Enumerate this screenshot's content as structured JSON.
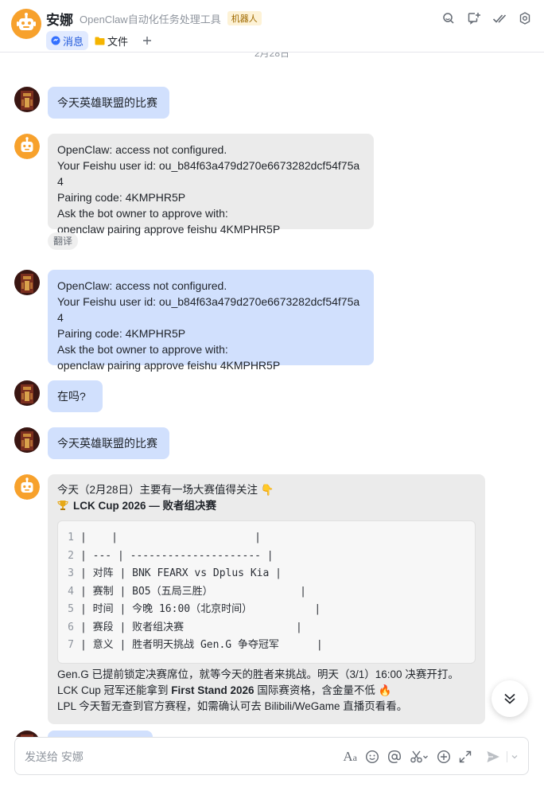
{
  "header": {
    "title": "安娜",
    "subtitle": "OpenClaw自动化任务处理工具",
    "badge": "机器人",
    "tabs": [
      {
        "label": "消息",
        "icon": "chat-bubble-icon",
        "active": true
      },
      {
        "label": "文件",
        "icon": "folder-icon",
        "active": false
      }
    ],
    "actions": [
      "search-icon",
      "add-chat-icon",
      "check-marks-icon",
      "settings-icon"
    ]
  },
  "date_divider": "2月28日",
  "messages": [
    {
      "sender": "user",
      "text": "今天英雄联盟的比赛"
    },
    {
      "sender": "bot",
      "text": "OpenClaw: access not configured.\nYour Feishu user id: ou_b84f63a479d270e6673282dcf54f75a4\nPairing code: 4KMPHR5P\nAsk the bot owner to approve with:\nopenclaw pairing approve feishu 4KMPHR5P",
      "action": "翻译"
    },
    {
      "sender": "user",
      "text": "OpenClaw: access not configured.\nYour Feishu user id: ou_b84f63a479d270e6673282dcf54f75a4\nPairing code: 4KMPHR5P\nAsk the bot owner to approve with:\nopenclaw pairing approve feishu 4KMPHR5P"
    },
    {
      "sender": "user",
      "text": "在吗?"
    },
    {
      "sender": "user",
      "text": "今天英雄联盟的比赛"
    }
  ],
  "rich_reply": {
    "intro": "今天（2月28日）主要有一场大赛值得关注 👇",
    "heading_icon": "trophy-icon",
    "heading": "LCK Cup 2026 — 败者组决赛",
    "code_lines": [
      {
        "n": "1",
        "text": "|    |                      |"
      },
      {
        "n": "2",
        "text": "| --- | --------------------- |"
      },
      {
        "n": "3",
        "text": "| 对阵 | BNK FEARX vs Dplus Kia |"
      },
      {
        "n": "4",
        "text": "| 赛制 | BO5（五局三胜）              |"
      },
      {
        "n": "5",
        "text": "| 时间 | 今晚 16:00（北京时间）          |"
      },
      {
        "n": "6",
        "text": "| 赛段 | 败者组决赛                  |"
      },
      {
        "n": "7",
        "text": "| 意义 | 胜者明天挑战 Gen.G 争夺冠军      |"
      }
    ],
    "para1": "Gen.G 已提前锁定决赛席位，就等今天的胜者来挑战。明天（3/1）16:00 决赛开打。",
    "para2_a": "LCK Cup 冠军还能拿到 ",
    "para2_b": "First Stand 2026",
    "para2_c": " 国际赛资格，含金量不低 🔥",
    "para3": "LPL 今天暂无查到官方赛程，如需确认可去 Bilibili/WeGame 直播页看看。"
  },
  "composer": {
    "placeholder": "发送给 安娜",
    "tools": [
      "text-format-icon",
      "emoji-icon",
      "mention-icon",
      "screenshot-icon",
      "add-circle-icon",
      "expand-icon",
      "send-icon",
      "chevron-down-icon"
    ]
  },
  "colors": {
    "user_bubble": "#d1e0fd",
    "bot_bubble": "#ebebeb",
    "accent": "#245bdb",
    "bot_avatar": "#f7a12c"
  }
}
